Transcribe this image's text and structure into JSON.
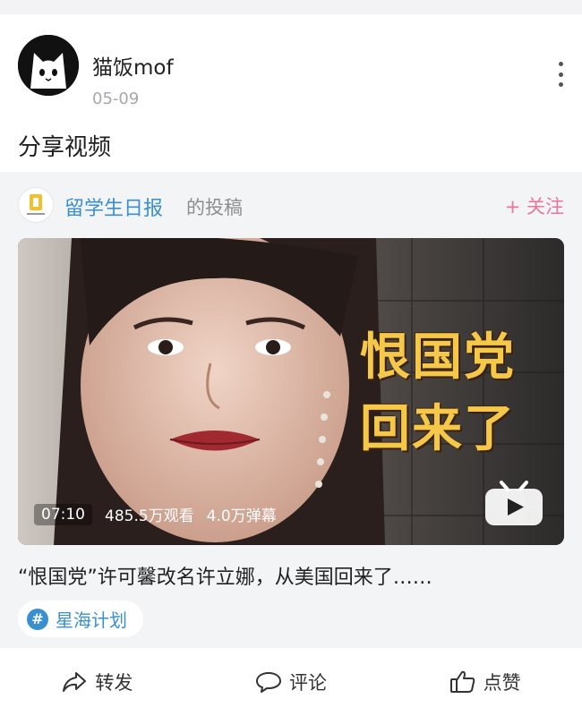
{
  "post": {
    "author": "猫饭mof",
    "date": "05-09",
    "text": "分享视频"
  },
  "repost": {
    "source_name": "留学生日报",
    "source_suffix": "的投稿",
    "follow_label": "+ 关注"
  },
  "video": {
    "overlay_line1": "恨国党",
    "overlay_line2": "回来了",
    "duration": "07:10",
    "views": "485.5万观看",
    "danmaku": "4.0万弹幕",
    "title": "“恨国党”许可馨改名许立娜，从美国回来了……"
  },
  "topic": {
    "label": "星海计划"
  },
  "actions": {
    "repost": "转发",
    "comment": "评论",
    "like": "点赞"
  },
  "colors": {
    "link_blue": "#3a90cf",
    "follow_pink": "#e8769a",
    "overlay_yellow": "#f6c84a"
  }
}
